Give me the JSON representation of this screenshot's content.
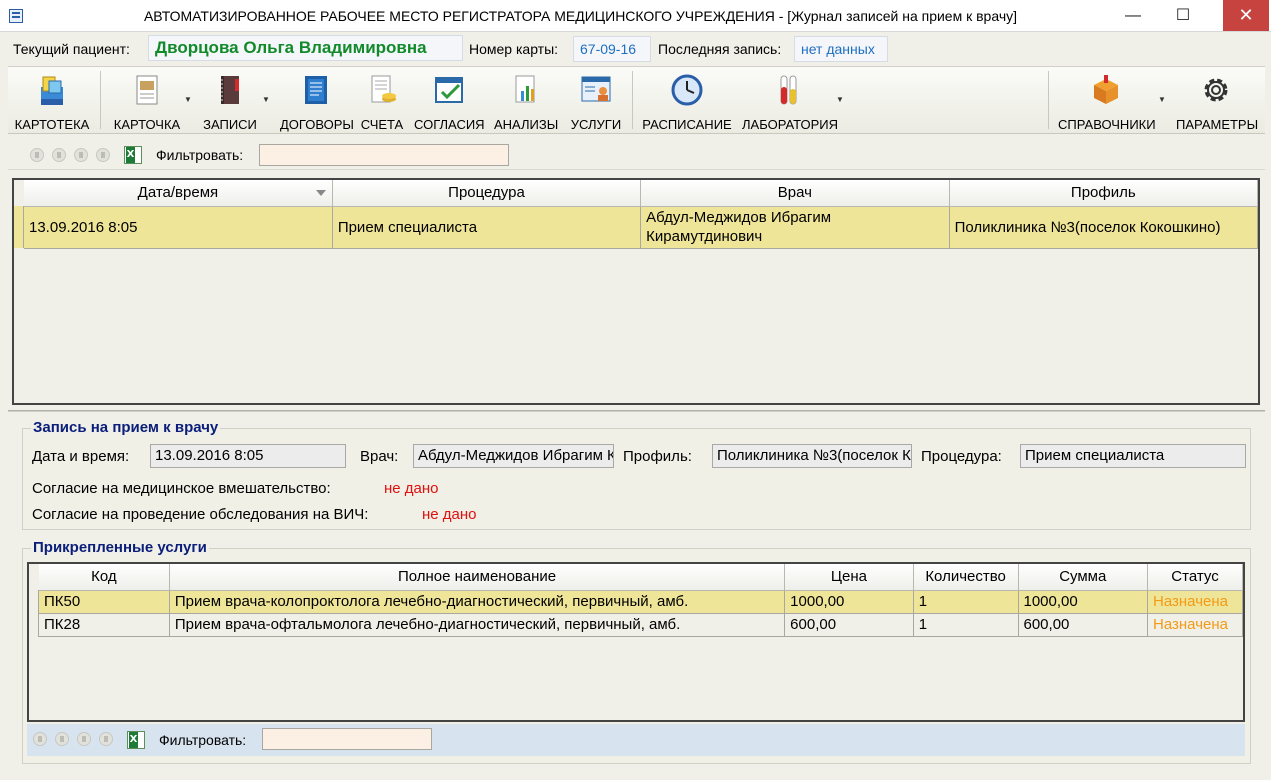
{
  "window": {
    "title": "АВТОМАТИЗИРОВАННОЕ РАБОЧЕЕ МЕСТО РЕГИСТРАТОРА МЕДИЦИНСКОГО УЧРЕЖДЕНИЯ - [Журнал записей на прием к врачу]",
    "minimize": "—",
    "maximize": "☐",
    "close": "✕"
  },
  "patient_bar": {
    "current_patient_label": "Текущий пациент:",
    "current_patient": "Дворцова Ольга Владимировна",
    "card_number_label": "Номер карты:",
    "card_number": "67-09-16",
    "last_record_label": "Последняя запись:",
    "last_record": "нет данных"
  },
  "toolbar": {
    "items": [
      {
        "label": "КАРТОТЕКА",
        "icon": "card-index-icon"
      },
      {
        "label": "КАРТОЧКА",
        "icon": "patient-card-icon",
        "dropdown": true
      },
      {
        "label": "ЗАПИСИ",
        "icon": "records-book-icon",
        "dropdown": true
      },
      {
        "label": "ДОГОВОРЫ",
        "icon": "contracts-icon"
      },
      {
        "label": "СЧЕТА",
        "icon": "invoices-icon"
      },
      {
        "label": "СОГЛАСИЯ",
        "icon": "consents-icon"
      },
      {
        "label": "АНАЛИЗЫ",
        "icon": "analyses-icon"
      },
      {
        "label": "УСЛУГИ",
        "icon": "services-icon"
      },
      {
        "label": "РАСПИСАНИЕ",
        "icon": "clock-icon"
      },
      {
        "label": "ЛАБОРАТОРИЯ",
        "icon": "test-tubes-icon",
        "dropdown": true
      },
      {
        "label": "СПРАВОЧНИКИ",
        "icon": "box-icon",
        "dropdown": true
      },
      {
        "label": "ПАРАМЕТРЫ",
        "icon": "gear-icon"
      }
    ]
  },
  "filter_top": {
    "label": "Фильтровать:",
    "value": ""
  },
  "appointments_grid": {
    "columns": [
      "Дата/время",
      "Процедура",
      "Врач",
      "Профиль"
    ],
    "sorted_column": "Дата/время",
    "rows": [
      [
        "13.09.2016 8:05",
        "Прием специалиста",
        "Абдул-Меджидов Ибрагим Кирамутдинович",
        "Поликлиника №3(поселок Кокошкино)"
      ]
    ]
  },
  "appointment_detail": {
    "section_title": "Запись на прием к врачу",
    "datetime_label": "Дата и время:",
    "datetime": "13.09.2016 8:05",
    "doctor_label": "Врач:",
    "doctor": "Абдул-Меджидов Ибрагим Кирамутдинович",
    "profile_label": "Профиль:",
    "profile": "Поликлиника №3(поселок Кокошкино)",
    "procedure_label": "Процедура:",
    "procedure": "Прием специалиста",
    "consent_medical_label": "Согласие на медицинское вмешательство:",
    "consent_medical": "не дано",
    "consent_hiv_label": "Согласие на проведение обследования на ВИЧ:",
    "consent_hiv": "не дано"
  },
  "attached_services": {
    "section_title": "Прикрепленные услуги",
    "columns": [
      "Код",
      "Полное наименование",
      "Цена",
      "Количество",
      "Сумма",
      "Статус"
    ],
    "rows": [
      [
        "ПК50",
        "Прием врача-колопроктолога лечебно-диагностический, первичный, амб.",
        "1000,00",
        "1",
        "1000,00",
        "Назначена"
      ],
      [
        "ПК28",
        "Прием врача-офтальмолога лечебно-диагностический, первичный, амб.",
        "600,00",
        "1",
        "600,00",
        "Назначена"
      ]
    ]
  },
  "filter_bottom": {
    "label": "Фильтровать:",
    "value": ""
  },
  "colors": {
    "selected_row": "#efe598",
    "patient_name": "#128a2a",
    "section_title": "#0a1e7a",
    "status": "#f39a16",
    "not_given": "#e01010"
  }
}
